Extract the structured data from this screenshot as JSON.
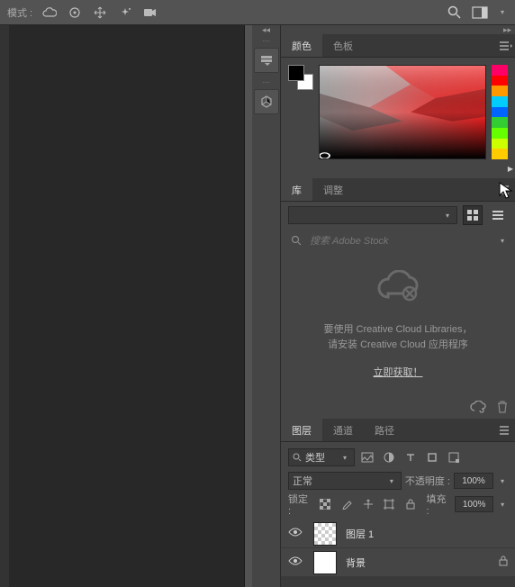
{
  "topbar": {
    "mode_label": "模式 :"
  },
  "panels": {
    "color": {
      "tab_color": "颜色",
      "tab_swatches": "色板"
    },
    "library": {
      "tab_lib": "库",
      "tab_adjust": "调整",
      "search_placeholder": "搜索 Adobe Stock",
      "msg_line1": "要使用 Creative Cloud Libraries，",
      "msg_line2": "请安装 Creative Cloud 应用程序",
      "link": "立即获取！"
    },
    "layers": {
      "tab_layers": "图层",
      "tab_channels": "通道",
      "tab_paths": "路径",
      "kind_label": "类型",
      "blend_mode": "正常",
      "opacity_label": "不透明度 :",
      "opacity_value": "100%",
      "lock_label": "锁定 :",
      "fill_label": "填充 :",
      "fill_value": "100%",
      "rows": [
        {
          "name": "图层 1",
          "locked": false
        },
        {
          "name": "背景",
          "locked": true
        }
      ]
    }
  },
  "hues": [
    "#ff0000",
    "#ff7f00",
    "#ffff00",
    "#7fff00",
    "#00ff00",
    "#00ff7f",
    "#00ffff",
    "#007fff",
    "#0000ff",
    "#7f00ff",
    "#ff00ff",
    "#ff007f"
  ]
}
